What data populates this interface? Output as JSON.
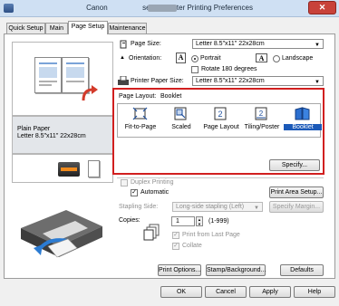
{
  "window": {
    "title_prefix": "Canon",
    "title_suffix": "series Printer Printing Preferences",
    "close_symbol": "✕"
  },
  "tabs": [
    {
      "label": "Quick Setup"
    },
    {
      "label": "Main"
    },
    {
      "label": "Page Setup",
      "active": true
    },
    {
      "label": "Maintenance"
    }
  ],
  "preview": {
    "media_type": "Plain Paper",
    "paper_info": "Letter 8.5\"x11\" 22x28cm"
  },
  "page_setup": {
    "page_size_label": "Page Size:",
    "page_size_value": "Letter 8.5\"x11\" 22x28cm",
    "orientation_label": "Orientation:",
    "portrait_label": "Portrait",
    "landscape_label": "Landscape",
    "rotate_label": "Rotate 180 degrees",
    "printer_paper_size_label": "Printer Paper Size:",
    "printer_paper_size_value": "Letter 8.5\"x11\" 22x28cm",
    "page_layout_label": "Page Layout:",
    "page_layout_value": "Booklet",
    "layout_items": [
      {
        "label": "Fit-to-Page",
        "icon": "fit-to-page-icon"
      },
      {
        "label": "Scaled",
        "icon": "scaled-icon"
      },
      {
        "label": "Page Layout",
        "icon": "page-layout-icon"
      },
      {
        "label": "Tiling/Poster",
        "icon": "tiling-poster-icon"
      },
      {
        "label": "Booklet",
        "icon": "booklet-icon",
        "selected": true
      }
    ],
    "specify_label": "Specify...",
    "duplex_label": "Duplex Printing",
    "automatic_label": "Automatic",
    "print_area_setup_label": "Print Area Setup...",
    "stapling_side_label": "Stapling Side:",
    "stapling_side_value": "Long-side stapling (Left)",
    "specify_margin_label": "Specify Margin...",
    "copies_label": "Copies:",
    "copies_value": "1",
    "copies_range": "(1-999)",
    "print_from_last_label": "Print from Last Page",
    "collate_label": "Collate",
    "print_options_label": "Print Options...",
    "stamp_background_label": "Stamp/Background...",
    "defaults_label": "Defaults"
  },
  "footer": {
    "ok_label": "OK",
    "cancel_label": "Cancel",
    "apply_label": "Apply",
    "help_label": "Help"
  },
  "colors": {
    "highlight_frame": "#d11f1f",
    "selection": "#1b59b8"
  }
}
